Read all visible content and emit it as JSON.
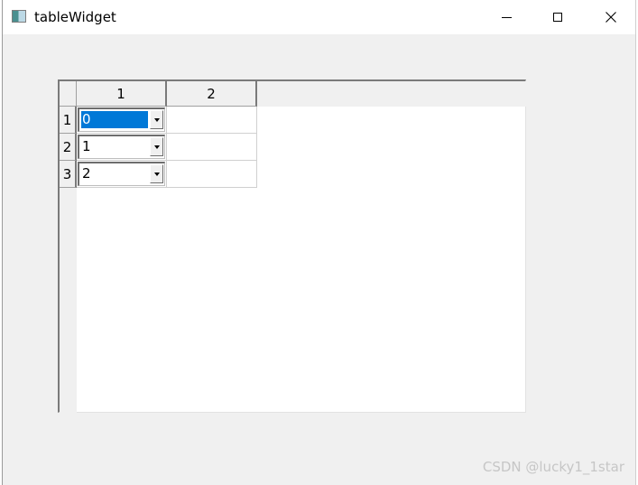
{
  "window": {
    "title": "tableWidget"
  },
  "table": {
    "column_headers": [
      "1",
      "2"
    ],
    "row_headers": [
      "1",
      "2",
      "3"
    ],
    "rows": [
      {
        "combo_value": "0",
        "combo_selected": true,
        "col2": ""
      },
      {
        "combo_value": "1",
        "combo_selected": false,
        "col2": ""
      },
      {
        "combo_value": "2",
        "combo_selected": false,
        "col2": ""
      }
    ]
  },
  "icons": {
    "app": "app-window-icon",
    "minimize": "minimize-icon",
    "maximize": "maximize-icon",
    "close": "close-icon",
    "dropdown": "chevron-down-icon"
  },
  "colors": {
    "selection": "#0078d7",
    "header_bg": "#f0f0f0",
    "watermark": "#c6c6c6"
  },
  "watermark": "CSDN @lucky1_1star"
}
